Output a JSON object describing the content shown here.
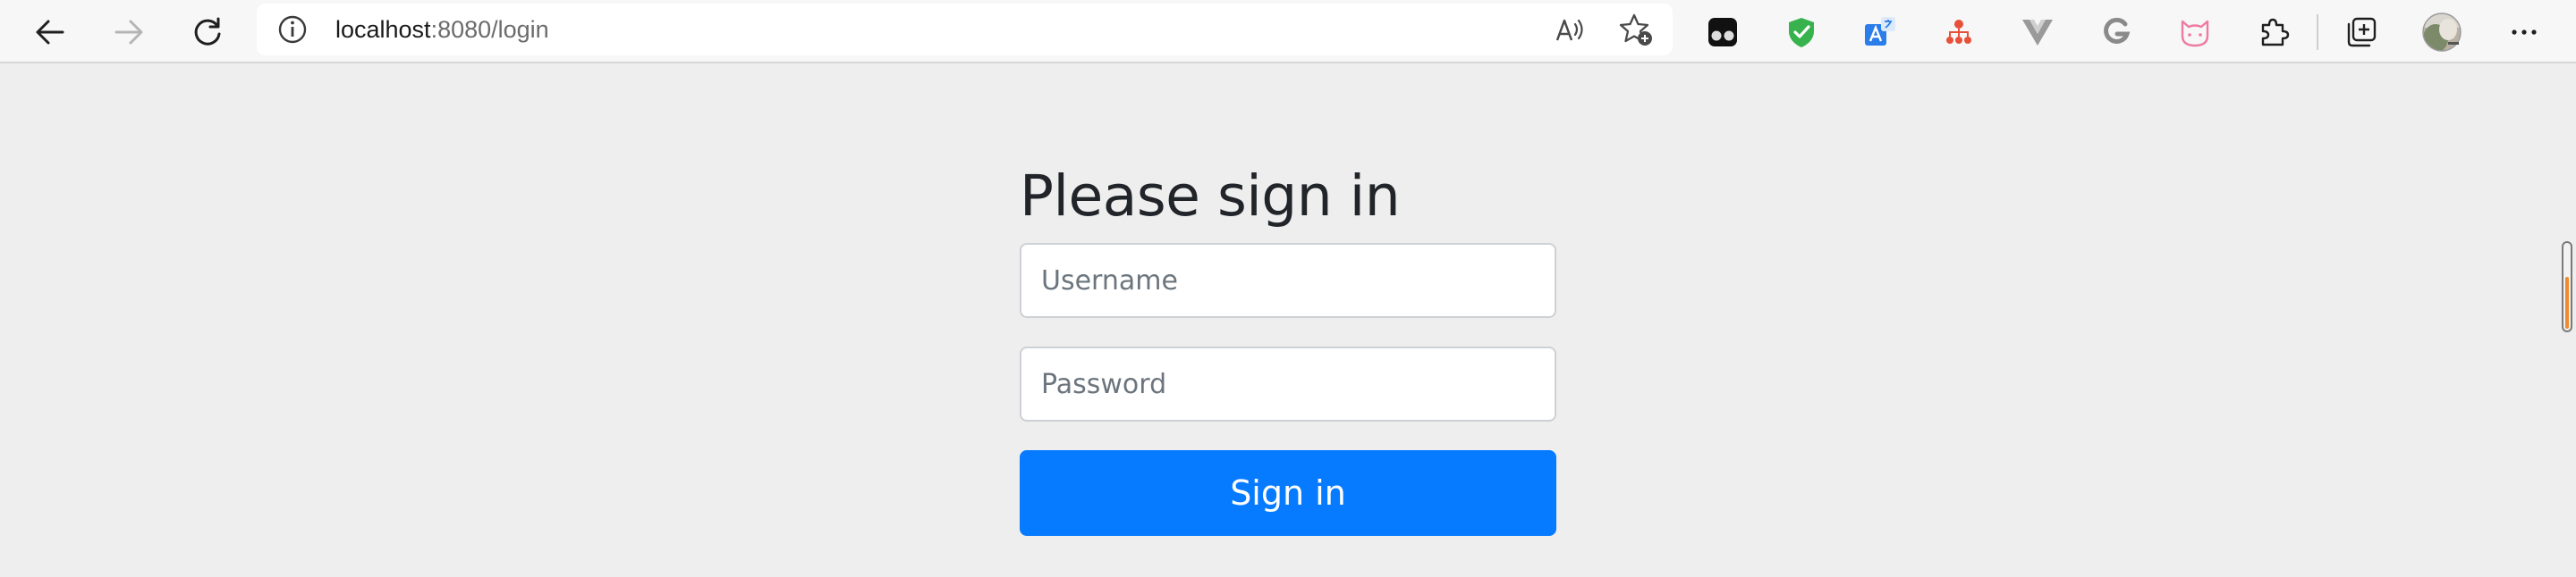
{
  "browser": {
    "address": {
      "host": "localhost",
      "rest": ":8080/login"
    },
    "icons": {
      "back": "arrow-left-icon",
      "forward": "arrow-right-icon",
      "refresh": "refresh-icon",
      "info": "info-icon",
      "read_aloud": "read-aloud-icon",
      "favorite": "add-favorite-icon",
      "extensions": [
        "tampermonkey-icon",
        "adguard-shield-icon",
        "translate-icon",
        "sitemap-icon",
        "vue-devtools-icon",
        "grammarly-g-icon",
        "cat-icon",
        "extensions-puzzle-icon"
      ],
      "collections": "collections-icon",
      "profile": "profile-avatar",
      "menu": "more-menu-icon"
    }
  },
  "login": {
    "heading": "Please sign in",
    "username_placeholder": "Username",
    "password_placeholder": "Password",
    "submit_label": "Sign in"
  },
  "colors": {
    "page_bg": "#eeeeee",
    "primary": "#077bff",
    "scroll_accent": "#f08a2c"
  }
}
